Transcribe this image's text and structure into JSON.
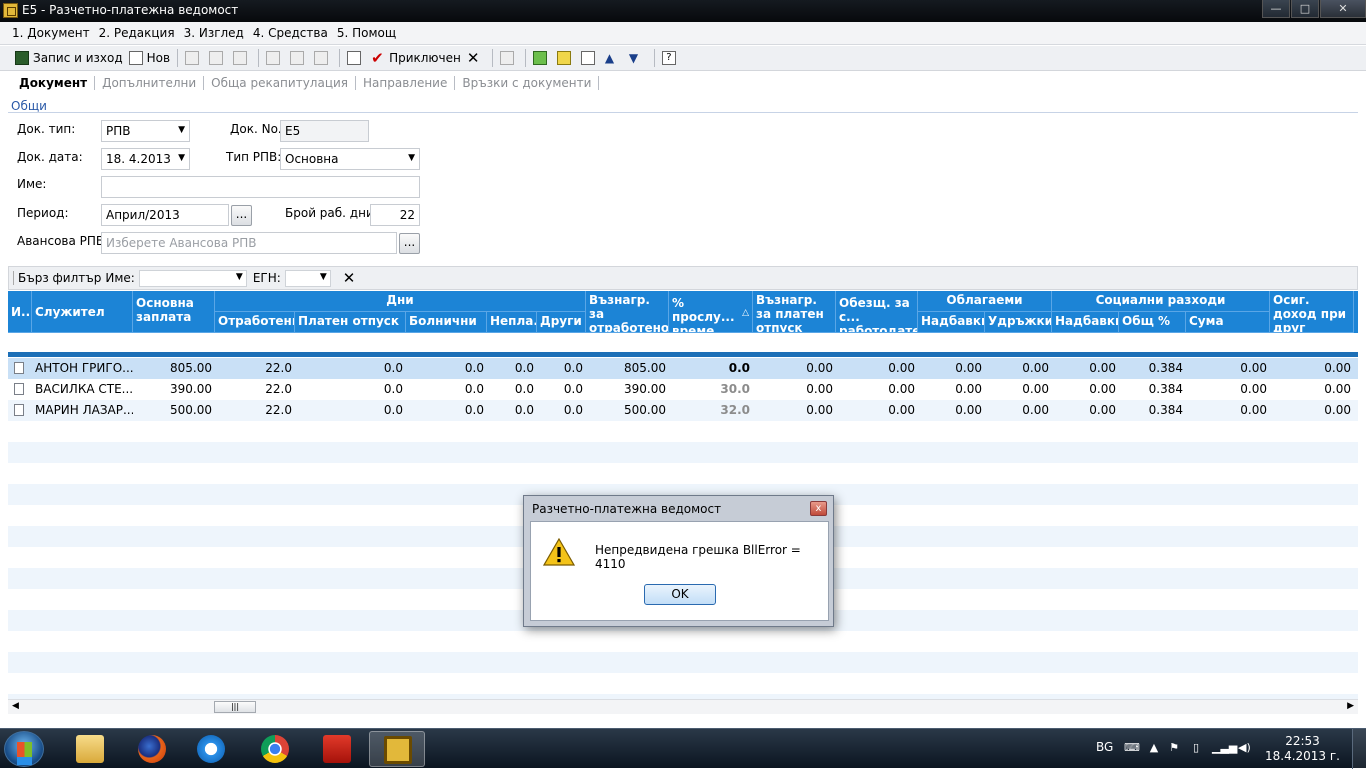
{
  "window": {
    "title": "Е5 - Разчетно-платежна ведомост",
    "controls": {
      "minimize": "—",
      "maximize": "□",
      "close": "✕"
    }
  },
  "menu": [
    "1. Документ",
    "2. Редакция",
    "3. Изглед",
    "4. Средства",
    "5. Помощ"
  ],
  "toolbar": {
    "save_exit": "Запис и изход",
    "new": "Нов",
    "complete": "Приключен"
  },
  "tabs": [
    "Документ",
    "Допълнителни",
    "Обща рекапитулация",
    "Направление",
    "Връзки с документи"
  ],
  "group_title": "Общи",
  "form": {
    "doc_type_label": "Док. тип:",
    "doc_type_value": "РПВ",
    "doc_no_label": "Док. No.",
    "doc_no_value": "Е5",
    "doc_date_label": "Док. дата:",
    "doc_date_value": "18.  4.2013",
    "rpv_type_label": "Тип РПВ:",
    "rpv_type_value": "Основна",
    "name_label": "Име:",
    "name_value": "",
    "period_label": "Период:",
    "period_value": "Април/2013",
    "work_days_label": "Брой раб. дни:",
    "work_days_value": "22",
    "advance_label": "Авансова РПВ:",
    "advance_placeholder": "Изберете Авансова РПВ",
    "browse_button": "..."
  },
  "filter": {
    "quick_filter_label": "Бърз филтър",
    "name_label": "Име:",
    "egn_label": "ЕГН:"
  },
  "grid": {
    "headers": {
      "id": "И...",
      "employee": "Служител",
      "base_salary": "Основна заплата",
      "days": "Дни",
      "worked": "Отработени",
      "paid_leave": "Платен отпуск",
      "sick": "Болнични",
      "unpaid": "Непла...",
      "other": "Други",
      "pay_worked": "Възнагр. за отработено време",
      "seniority": "% прослу... време",
      "pay_paid_leave": "Възнагр. за платен отпуск",
      "compensation": "Обезщ. за с... работодателя",
      "taxable": "Облагаеми",
      "taxable_bonus": "Надбавки",
      "taxable_deduct": "Удръжки",
      "social": "Социални разходи",
      "social_bonus": "Надбавки",
      "social_pct": "Общ %",
      "social_sum": "Сума",
      "insured_income": "Осиг. доход при друг работодател"
    },
    "rows": [
      {
        "name": "АНТОН ГРИГО...",
        "base": "805.00",
        "worked": "22.0",
        "paid_leave": "0.0",
        "sick": "0.0",
        "unpaid": "0.0",
        "other": "0.0",
        "pay": "805.00",
        "seniority": "0.0",
        "pay_leave": "0.00",
        "comp": "0.00",
        "tbonus": "0.00",
        "tdeduct": "0.00",
        "sbonus": "0.00",
        "spct": "0.384",
        "ssum": "0.00",
        "income": "0.00"
      },
      {
        "name": "ВАСИЛКА СТЕ...",
        "base": "390.00",
        "worked": "22.0",
        "paid_leave": "0.0",
        "sick": "0.0",
        "unpaid": "0.0",
        "other": "0.0",
        "pay": "390.00",
        "seniority": "30.0",
        "pay_leave": "0.00",
        "comp": "0.00",
        "tbonus": "0.00",
        "tdeduct": "0.00",
        "sbonus": "0.00",
        "spct": "0.384",
        "ssum": "0.00",
        "income": "0.00"
      },
      {
        "name": "МАРИН ЛАЗАР...",
        "base": "500.00",
        "worked": "22.0",
        "paid_leave": "0.0",
        "sick": "0.0",
        "unpaid": "0.0",
        "other": "0.0",
        "pay": "500.00",
        "seniority": "32.0",
        "pay_leave": "0.00",
        "comp": "0.00",
        "tbonus": "0.00",
        "tdeduct": "0.00",
        "sbonus": "0.00",
        "spct": "0.384",
        "ssum": "0.00",
        "income": "0.00"
      }
    ]
  },
  "dialog": {
    "title": "Разчетно-платежна ведомост",
    "message": "Непредвидена грешка BllError = 4110",
    "ok": "OK",
    "close": "x"
  },
  "taskbar": {
    "lang": "BG",
    "time": "22:53",
    "date": "18.4.2013 г."
  },
  "colors": {
    "grid_header": "#1c84d6",
    "selected_row": "#c9e0f6",
    "accent_blue": "#2b5aa8"
  }
}
